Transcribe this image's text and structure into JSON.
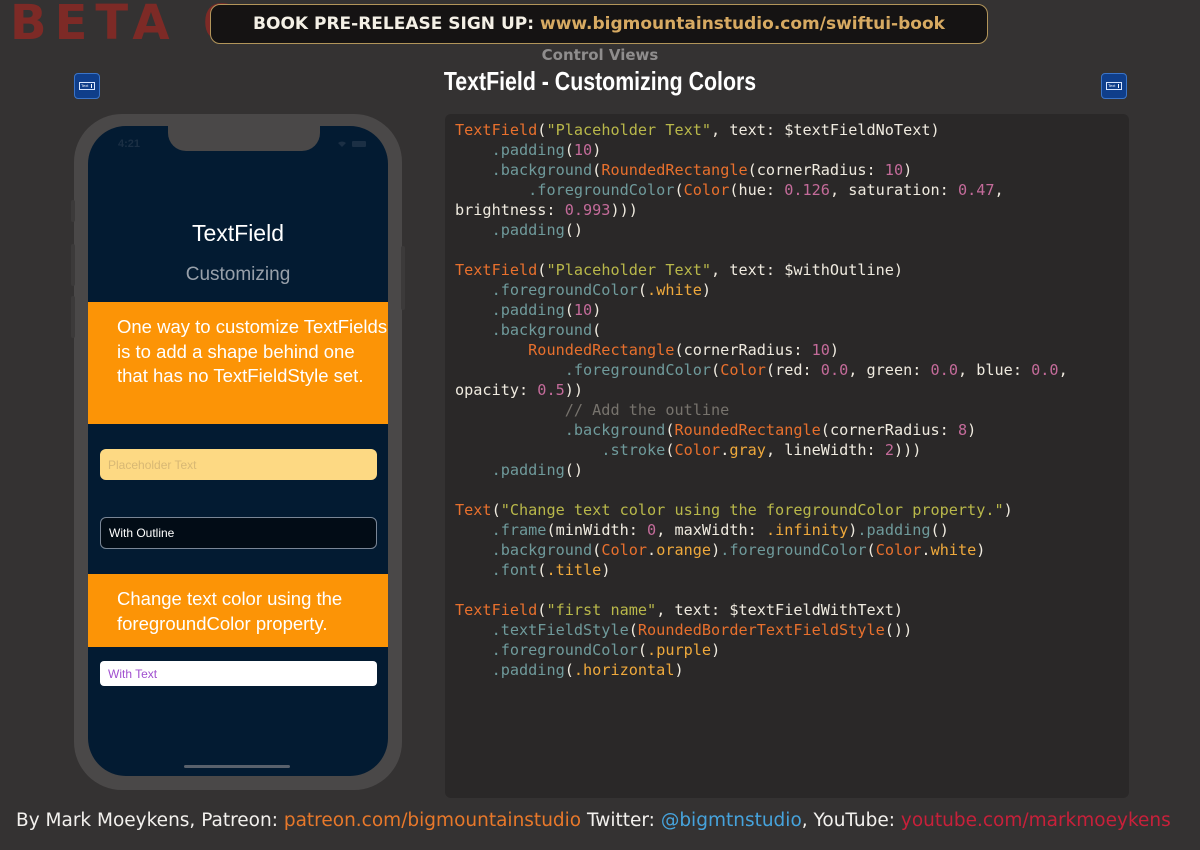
{
  "header": {
    "beta_label": "BETA 6",
    "banner_label": "BOOK PRE-RELEASE SIGN UP:",
    "banner_url": "www.bigmountainstudio.com/swiftui-book",
    "category": "Control Views",
    "title": "TextField - Customizing Colors",
    "icon_left": "textfield-icon",
    "icon_right": "textfield-icon",
    "icon_text": "Text"
  },
  "phone": {
    "status_time": "4:21",
    "title": "TextField",
    "subtitle": "Customizing",
    "description": "One way to customize TextFields is to add a shape behind one that has no TextFieldStyle set.",
    "field_no_text_placeholder": "Placeholder Text",
    "field_with_outline_value": "With Outline",
    "change_text_label": "Change text color using the foregroundColor property.",
    "field_with_text_value": "With Text"
  },
  "colors": {
    "background": "#343232",
    "screen": "#031b32",
    "orange": "#fc9406",
    "yellow_field": "#fdd983",
    "purple_text": "#a04fcf",
    "banner_url": "#d7aa62",
    "patreon": "#e8782a",
    "twitter": "#46a3dc",
    "youtube": "#c8203a"
  },
  "code": [
    [
      [
        "t-type",
        "TextField"
      ],
      [
        "t-plain",
        "("
      ],
      [
        "t-str",
        "\"Placeholder Text\""
      ],
      [
        "t-plain",
        ", text: $textFieldNoText)"
      ]
    ],
    [
      [
        "t-plain",
        "    "
      ],
      [
        "t-mod",
        ".padding"
      ],
      [
        "t-plain",
        "("
      ],
      [
        "t-num",
        "10"
      ],
      [
        "t-plain",
        ")"
      ]
    ],
    [
      [
        "t-plain",
        "    "
      ],
      [
        "t-mod",
        ".background"
      ],
      [
        "t-plain",
        "("
      ],
      [
        "t-type",
        "RoundedRectangle"
      ],
      [
        "t-plain",
        "(cornerRadius: "
      ],
      [
        "t-num",
        "10"
      ],
      [
        "t-plain",
        ")"
      ]
    ],
    [
      [
        "t-plain",
        "        "
      ],
      [
        "t-mod",
        ".foregroundColor"
      ],
      [
        "t-plain",
        "("
      ],
      [
        "t-type",
        "Color"
      ],
      [
        "t-plain",
        "(hue: "
      ],
      [
        "t-num",
        "0.126"
      ],
      [
        "t-plain",
        ", saturation: "
      ],
      [
        "t-num",
        "0.47"
      ],
      [
        "t-plain",
        ","
      ]
    ],
    [
      [
        "t-plain",
        "brightness: "
      ],
      [
        "t-num",
        "0.993"
      ],
      [
        "t-plain",
        ")))"
      ]
    ],
    [
      [
        "t-plain",
        "    "
      ],
      [
        "t-mod",
        ".padding"
      ],
      [
        "t-plain",
        "()"
      ]
    ],
    [],
    [
      [
        "t-type",
        "TextField"
      ],
      [
        "t-plain",
        "("
      ],
      [
        "t-str",
        "\"Placeholder Text\""
      ],
      [
        "t-plain",
        ", text: $withOutline)"
      ]
    ],
    [
      [
        "t-plain",
        "    "
      ],
      [
        "t-mod",
        ".foregroundColor"
      ],
      [
        "t-plain",
        "("
      ],
      [
        "t-enum",
        ".white"
      ],
      [
        "t-plain",
        ")"
      ]
    ],
    [
      [
        "t-plain",
        "    "
      ],
      [
        "t-mod",
        ".padding"
      ],
      [
        "t-plain",
        "("
      ],
      [
        "t-num",
        "10"
      ],
      [
        "t-plain",
        ")"
      ]
    ],
    [
      [
        "t-plain",
        "    "
      ],
      [
        "t-mod",
        ".background"
      ],
      [
        "t-plain",
        "("
      ]
    ],
    [
      [
        "t-plain",
        "        "
      ],
      [
        "t-type",
        "RoundedRectangle"
      ],
      [
        "t-plain",
        "(cornerRadius: "
      ],
      [
        "t-num",
        "10"
      ],
      [
        "t-plain",
        ")"
      ]
    ],
    [
      [
        "t-plain",
        "            "
      ],
      [
        "t-mod",
        ".foregroundColor"
      ],
      [
        "t-plain",
        "("
      ],
      [
        "t-type",
        "Color"
      ],
      [
        "t-plain",
        "(red: "
      ],
      [
        "t-num",
        "0.0"
      ],
      [
        "t-plain",
        ", green: "
      ],
      [
        "t-num",
        "0.0"
      ],
      [
        "t-plain",
        ", blue: "
      ],
      [
        "t-num",
        "0.0"
      ],
      [
        "t-plain",
        ","
      ]
    ],
    [
      [
        "t-plain",
        "opacity: "
      ],
      [
        "t-num",
        "0.5"
      ],
      [
        "t-plain",
        "))"
      ]
    ],
    [
      [
        "t-plain",
        "            "
      ],
      [
        "t-com",
        "// Add the outline"
      ]
    ],
    [
      [
        "t-plain",
        "            "
      ],
      [
        "t-mod",
        ".background"
      ],
      [
        "t-plain",
        "("
      ],
      [
        "t-type",
        "RoundedRectangle"
      ],
      [
        "t-plain",
        "(cornerRadius: "
      ],
      [
        "t-num",
        "8"
      ],
      [
        "t-plain",
        ")"
      ]
    ],
    [
      [
        "t-plain",
        "                "
      ],
      [
        "t-mod",
        ".stroke"
      ],
      [
        "t-plain",
        "("
      ],
      [
        "t-type",
        "Color"
      ],
      [
        "t-plain",
        "."
      ],
      [
        "t-enum",
        "gray"
      ],
      [
        "t-plain",
        ", lineWidth: "
      ],
      [
        "t-num",
        "2"
      ],
      [
        "t-plain",
        ")))"
      ]
    ],
    [
      [
        "t-plain",
        "    "
      ],
      [
        "t-mod",
        ".padding"
      ],
      [
        "t-plain",
        "()"
      ]
    ],
    [],
    [
      [
        "t-type",
        "Text"
      ],
      [
        "t-plain",
        "("
      ],
      [
        "t-str",
        "\"Change text color using the foregroundColor property.\""
      ],
      [
        "t-plain",
        ")"
      ]
    ],
    [
      [
        "t-plain",
        "    "
      ],
      [
        "t-mod",
        ".frame"
      ],
      [
        "t-plain",
        "(minWidth: "
      ],
      [
        "t-num",
        "0"
      ],
      [
        "t-plain",
        ", maxWidth: "
      ],
      [
        "t-enum",
        ".infinity"
      ],
      [
        "t-plain",
        ")"
      ],
      [
        "t-mod",
        ".padding"
      ],
      [
        "t-plain",
        "()"
      ]
    ],
    [
      [
        "t-plain",
        "    "
      ],
      [
        "t-mod",
        ".background"
      ],
      [
        "t-plain",
        "("
      ],
      [
        "t-type",
        "Color"
      ],
      [
        "t-plain",
        "."
      ],
      [
        "t-enum",
        "orange"
      ],
      [
        "t-plain",
        ")"
      ],
      [
        "t-mod",
        ".foregroundColor"
      ],
      [
        "t-plain",
        "("
      ],
      [
        "t-type",
        "Color"
      ],
      [
        "t-plain",
        "."
      ],
      [
        "t-enum",
        "white"
      ],
      [
        "t-plain",
        ")"
      ]
    ],
    [
      [
        "t-plain",
        "    "
      ],
      [
        "t-mod",
        ".font"
      ],
      [
        "t-plain",
        "("
      ],
      [
        "t-enum",
        ".title"
      ],
      [
        "t-plain",
        ")"
      ]
    ],
    [],
    [
      [
        "t-type",
        "TextField"
      ],
      [
        "t-plain",
        "("
      ],
      [
        "t-str",
        "\"first name\""
      ],
      [
        "t-plain",
        ", text: $textFieldWithText)"
      ]
    ],
    [
      [
        "t-plain",
        "    "
      ],
      [
        "t-mod",
        ".textFieldStyle"
      ],
      [
        "t-plain",
        "("
      ],
      [
        "t-type",
        "RoundedBorderTextFieldStyle"
      ],
      [
        "t-plain",
        "())"
      ]
    ],
    [
      [
        "t-plain",
        "    "
      ],
      [
        "t-mod",
        ".foregroundColor"
      ],
      [
        "t-plain",
        "("
      ],
      [
        "t-enum",
        ".purple"
      ],
      [
        "t-plain",
        ")"
      ]
    ],
    [
      [
        "t-plain",
        "    "
      ],
      [
        "t-mod",
        ".padding"
      ],
      [
        "t-plain",
        "("
      ],
      [
        "t-enum",
        ".horizontal"
      ],
      [
        "t-plain",
        ")"
      ]
    ]
  ],
  "footer": {
    "by": "By Mark Moeykens, Patreon: ",
    "patreon": "patreon.com/bigmountainstudio",
    "twitter_label": " Twitter: ",
    "twitter": "@bigmtnstudio",
    "youtube_label": ", YouTube: ",
    "youtube": "youtube.com/markmoeykens"
  }
}
